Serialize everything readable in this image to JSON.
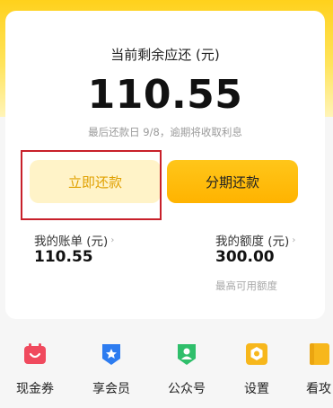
{
  "summary": {
    "title": "当前剩余应还 (元)",
    "amount": "110.55",
    "due_note": "最后还款日 9/8，逾期将收取利息"
  },
  "actions": {
    "repay_label": "立即还款",
    "installment_label": "分期还款"
  },
  "stats": {
    "bill_label": "我的账单 (元)",
    "bill_value": "110.55",
    "limit_label": "我的额度 (元)",
    "limit_value": "300.00",
    "limit_sub": "最高可用额度"
  },
  "quicknav": {
    "items": [
      {
        "label": "现金券",
        "icon": "coupon-icon",
        "color": "#f04a5e"
      },
      {
        "label": "享会员",
        "icon": "member-badge-icon",
        "color": "#2d7cf0"
      },
      {
        "label": "公众号",
        "icon": "official-account-icon",
        "color": "#2fbf6b"
      },
      {
        "label": "设置",
        "icon": "settings-icon",
        "color": "#f7b71c"
      },
      {
        "label": "看攻",
        "icon": "guide-icon",
        "color": "#f7b71c"
      }
    ]
  },
  "colors": {
    "accent": "#ffb300",
    "highlight_border": "#c8202a"
  }
}
